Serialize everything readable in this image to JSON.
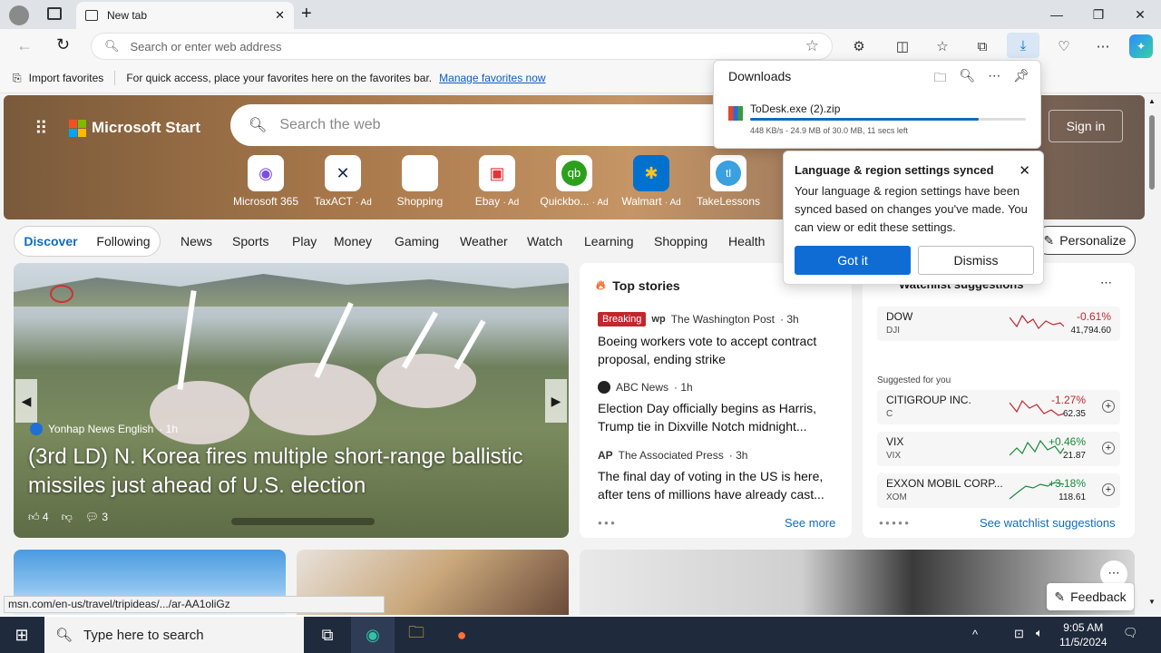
{
  "browser": {
    "tab_title": "New tab",
    "address_placeholder": "Search or enter web address"
  },
  "favorites": {
    "import_label": "Import favorites",
    "hint": "For quick access, place your favorites here on the favorites bar.",
    "manage_link": "Manage favorites now"
  },
  "header": {
    "brand": "Microsoft Start",
    "search_placeholder": "Search the web",
    "signin": "Sign in"
  },
  "quicklinks": [
    {
      "label": "Microsoft 365",
      "ad": ""
    },
    {
      "label": "TaxACT",
      "ad": "· Ad"
    },
    {
      "label": "Shopping",
      "ad": ""
    },
    {
      "label": "Ebay",
      "ad": "· Ad"
    },
    {
      "label": "Quickbo...",
      "ad": "· Ad"
    },
    {
      "label": "Walmart",
      "ad": "· Ad"
    },
    {
      "label": "TakeLessons",
      "ad": ""
    }
  ],
  "nav": {
    "discover": "Discover",
    "following": "Following",
    "links": [
      "News",
      "Sports",
      "Play",
      "Money",
      "Gaming",
      "Weather",
      "Watch",
      "Learning",
      "Shopping",
      "Health"
    ],
    "personalize": "Personalize"
  },
  "main_card": {
    "source": "Yonhap News English",
    "age": "· 1h",
    "title": "(3rd LD) N. Korea fires multiple short-range ballistic missiles just ahead of U.S. election",
    "likes": "4",
    "comments": "3"
  },
  "top_stories": {
    "heading": "Top stories",
    "items": [
      {
        "badge": "Breaking",
        "source": "The Washington Post",
        "age": "· 3h",
        "title": "Boeing workers vote to accept contract proposal, ending strike"
      },
      {
        "badge": "",
        "source": "ABC News",
        "age": "· 1h",
        "title": "Election Day officially begins as Harris, Trump tie in Dixville Notch midnight..."
      },
      {
        "badge": "",
        "source": "The Associated Press",
        "age": "· 3h",
        "title": "The final day of voting in the US is here, after tens of millions have already cast..."
      }
    ],
    "see_more": "See more"
  },
  "watchlist": {
    "heading": "Watchlist suggestions",
    "suggested_label": "Suggested for you",
    "see_all": "See watchlist suggestions",
    "stocks": [
      {
        "name": "DOW",
        "ticker": "DJI",
        "change": "-0.61%",
        "price": "41,794.60",
        "color": "#c4262e"
      },
      {
        "name": "CITIGROUP INC.",
        "ticker": "C",
        "change": "-1.27%",
        "price": "62.35",
        "color": "#c4262e"
      },
      {
        "name": "VIX",
        "ticker": "VIX",
        "change": "+0.46%",
        "price": "21.87",
        "color": "#1a8a3a"
      },
      {
        "name": "EXXON MOBIL CORP...",
        "ticker": "XOM",
        "change": "+3.18%",
        "price": "118.61",
        "color": "#1a8a3a"
      }
    ]
  },
  "downloads": {
    "heading": "Downloads",
    "file": "ToDesk.exe (2).zip",
    "progress": 0.83,
    "status": "448 KB/s - 24.9 MB of 30.0 MB, 11 secs left"
  },
  "sync_popup": {
    "title": "Language & region settings synced",
    "body": "Your language & region settings have been synced based on changes you've made. You can view or edit these settings.",
    "got_it": "Got it",
    "dismiss": "Dismiss"
  },
  "status_url": "msn.com/en-us/travel/tripideas/.../ar-AA1oliGz",
  "feedback": "Feedback",
  "taskbar": {
    "search_placeholder": "Type here to search",
    "time": "9:05 AM",
    "date": "11/5/2024"
  }
}
